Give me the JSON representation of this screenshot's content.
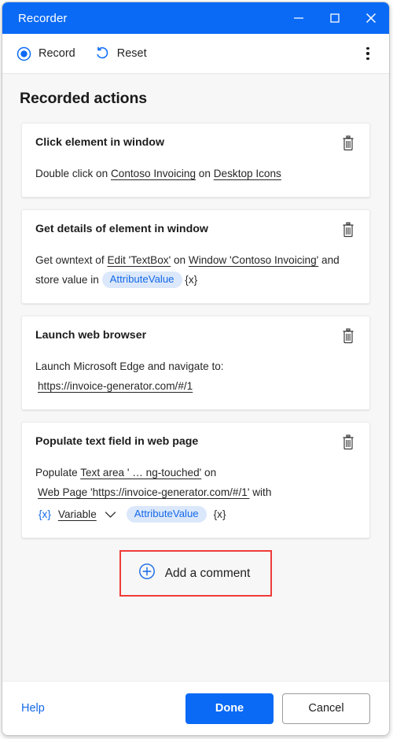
{
  "window": {
    "title": "Recorder",
    "minimize_label": "Minimize",
    "maximize_label": "Maximize",
    "close_label": "Close"
  },
  "toolbar": {
    "record_label": "Record",
    "reset_label": "Reset",
    "more_label": "More options"
  },
  "main": {
    "heading": "Recorded actions",
    "actions": [
      {
        "title": "Click element in window",
        "delete_label": "Delete",
        "parts": [
          {
            "text": "Double click on ",
            "style": "plain"
          },
          {
            "text": "Contoso Invoicing",
            "style": "underline"
          },
          {
            "text": " on ",
            "style": "plain"
          },
          {
            "text": "Desktop Icons",
            "style": "underline"
          }
        ]
      },
      {
        "title": "Get details of element in window",
        "delete_label": "Delete",
        "parts": [
          {
            "text": "Get owntext of ",
            "style": "plain"
          },
          {
            "text": "Edit 'TextBox'",
            "style": "underline"
          },
          {
            "text": " on ",
            "style": "plain"
          },
          {
            "text": "Window 'Contoso Invoicing'",
            "style": "underline"
          },
          {
            "text": " and store value in ",
            "style": "plain"
          },
          {
            "text": "AttributeValue",
            "style": "pill"
          },
          {
            "text": "{x}",
            "style": "variable"
          }
        ]
      },
      {
        "title": "Launch web browser",
        "delete_label": "Delete",
        "parts": [
          {
            "text": "Launch Microsoft Edge and navigate to:",
            "style": "plain"
          },
          {
            "text": "BREAK",
            "style": "break"
          },
          {
            "text": "https://invoice-generator.com/#/1",
            "style": "underline-indent"
          }
        ]
      },
      {
        "title": "Populate text field in web page",
        "delete_label": "Delete",
        "parts": [
          {
            "text": "Populate ",
            "style": "plain"
          },
          {
            "text": "Text area ' …  ng-touched'",
            "style": "underline"
          },
          {
            "text": " on ",
            "style": "plain"
          },
          {
            "text": "BREAK",
            "style": "break"
          },
          {
            "text": "Web Page 'https://invoice-generator.com/#/1'",
            "style": "underline"
          },
          {
            "text": " with",
            "style": "plain"
          }
        ],
        "variable_row": {
          "token_left": "{x}",
          "variable_label": "Variable",
          "chevron": "chevron-down",
          "pill_label": "AttributeValue",
          "token_right": "{x}"
        }
      }
    ],
    "add_comment_label": "Add a comment",
    "highlight_color": "#ef3b39"
  },
  "footer": {
    "help_label": "Help",
    "done_label": "Done",
    "cancel_label": "Cancel"
  },
  "colors": {
    "accent": "#0a6af5",
    "pill_bg": "#dbe8fb",
    "pill_text": "#1569e8",
    "page_bg": "#f7f7f7"
  }
}
